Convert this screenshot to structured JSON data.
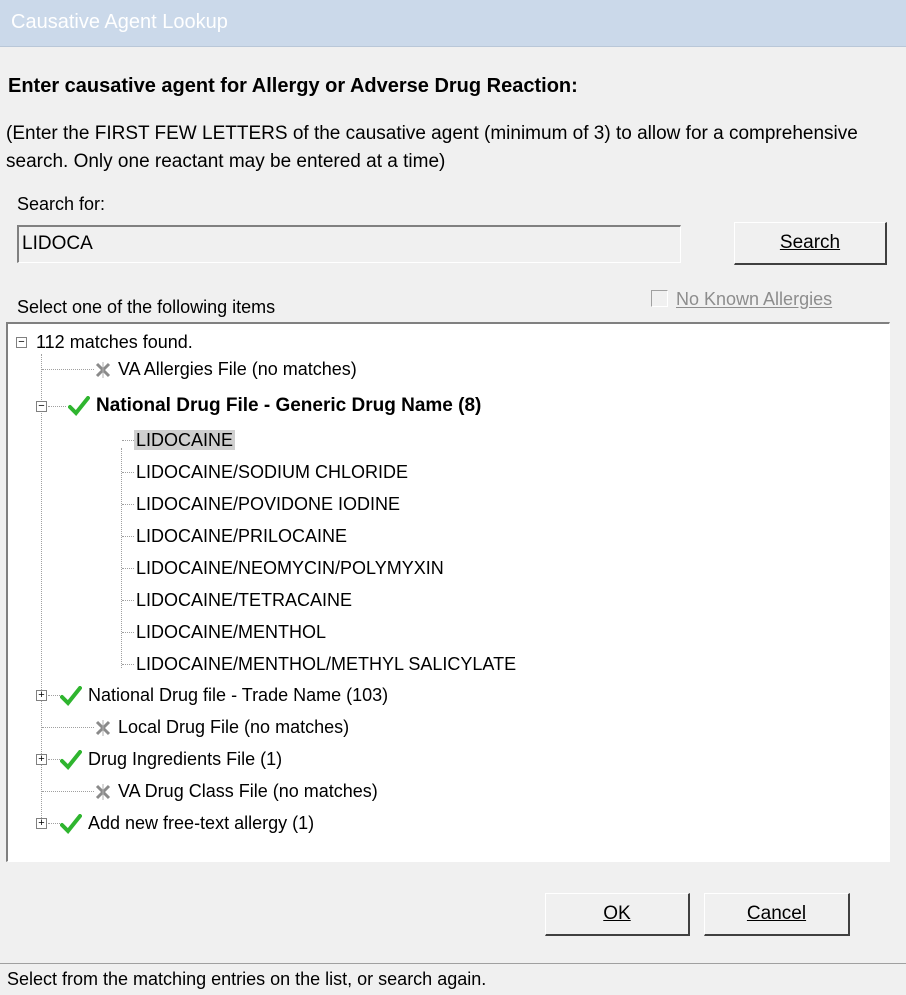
{
  "window": {
    "title": "Causative Agent Lookup"
  },
  "heading": "Enter causative agent for Allergy or Adverse Drug Reaction:",
  "instructions": "(Enter the FIRST FEW LETTERS of the causative agent (minimum of 3) to allow for a comprehensive search. Only one reactant may be entered at a time)",
  "search": {
    "label": "Search for:",
    "value": "LIDOCA",
    "button_label": "Search"
  },
  "list_label": "Select one of the following items",
  "no_known_allergies": {
    "label": "No Known Allergies",
    "checked": false,
    "enabled": false
  },
  "tree": {
    "root": "112 matches found.",
    "groups": [
      {
        "label": "VA Allergies File  (no matches)",
        "status": "none"
      },
      {
        "label": "National Drug File - Generic Drug Name  (8)",
        "status": "match",
        "expanded": true,
        "items": [
          "LIDOCAINE",
          "LIDOCAINE/SODIUM CHLORIDE",
          "LIDOCAINE/POVIDONE IODINE",
          "LIDOCAINE/PRILOCAINE",
          "LIDOCAINE/NEOMYCIN/POLYMYXIN",
          "LIDOCAINE/TETRACAINE",
          "LIDOCAINE/MENTHOL",
          "LIDOCAINE/MENTHOL/METHYL SALICYLATE"
        ]
      },
      {
        "label": "National Drug file - Trade Name  (103)",
        "status": "match"
      },
      {
        "label": "Local Drug File  (no matches)",
        "status": "none"
      },
      {
        "label": "Drug Ingredients File  (1)",
        "status": "match"
      },
      {
        "label": "VA Drug Class File  (no matches)",
        "status": "none"
      },
      {
        "label": "Add new free-text allergy  (1)",
        "status": "match"
      }
    ],
    "selected_item": "LIDOCAINE"
  },
  "buttons": {
    "ok": "OK",
    "cancel": "Cancel"
  },
  "status_bar": "Select from the matching entries on the list, or search again.",
  "colors": {
    "check": "#2fb52f",
    "title_bar": "#cbd9ea",
    "selection": "#cfcfcf"
  }
}
